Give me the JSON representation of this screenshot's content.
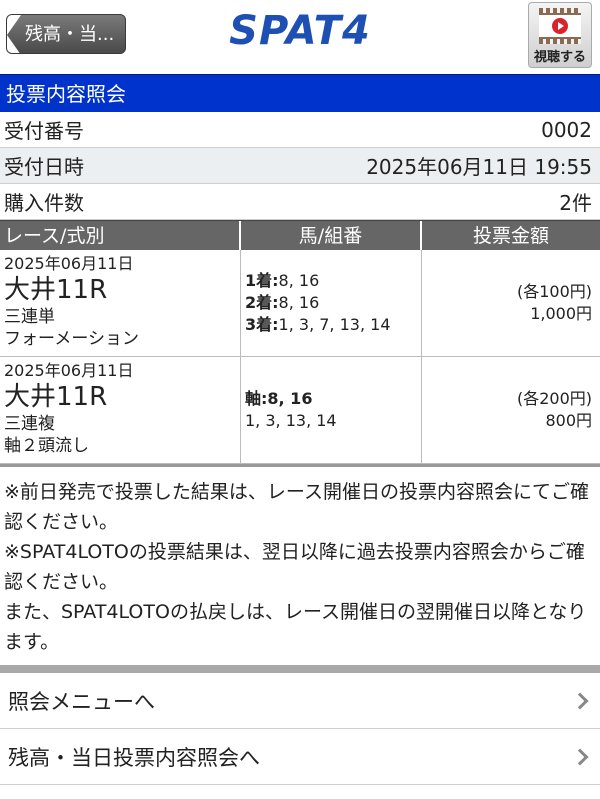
{
  "header": {
    "back_label": "残高・当...",
    "logo_text": "SPAT4",
    "watch_label": "視聴する"
  },
  "page": {
    "title": "投票内容照会"
  },
  "receipt": {
    "number_label": "受付番号",
    "number_value": "0002",
    "datetime_label": "受付日時",
    "datetime_value": "2025年06月11日 19:55",
    "count_label": "購入件数",
    "count_value": "2件"
  },
  "table": {
    "headers": [
      "レース/式別",
      "馬/組番",
      "投票金額"
    ],
    "rows": [
      {
        "date": "2025年06月11日",
        "venue": "大井11R",
        "bet_type": "三連単",
        "method": "フォーメーション",
        "combo": [
          {
            "label": "1着:",
            "value": "8, 16"
          },
          {
            "label": "2着:",
            "value": "8, 16"
          },
          {
            "label": "3着:",
            "value": "1, 3, 7, 13, 14"
          }
        ],
        "unit_amount": "(各100円)",
        "total_amount": "1,000円"
      },
      {
        "date": "2025年06月11日",
        "venue": "大井11R",
        "bet_type": "三連複",
        "method": "軸２頭流し",
        "axis_label": "軸:8, 16",
        "partners": "1, 3, 13, 14",
        "unit_amount": "(各200円)",
        "total_amount": "800円"
      }
    ]
  },
  "notes": [
    "※前日発売で投票した結果は、レース開催日の投票内容照会にてご確認ください。",
    "※SPAT4LOTOの投票結果は、翌日以降に過去投票内容照会からご確認ください。",
    "また、SPAT4LOTOの払戻しは、レース開催日の翌開催日以降となります。"
  ],
  "menu": {
    "items": [
      {
        "label": "照会メニューへ"
      },
      {
        "label": "残高・当日投票内容照会へ"
      }
    ]
  }
}
